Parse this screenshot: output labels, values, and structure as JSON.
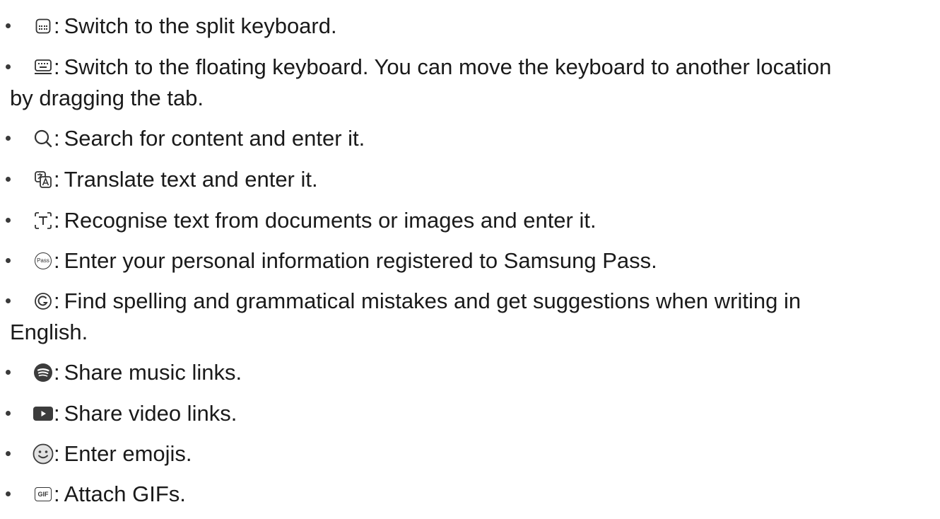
{
  "items": [
    {
      "icon": "split-keyboard-icon",
      "text": "Switch to the split keyboard."
    },
    {
      "icon": "floating-keyboard-icon",
      "text": "Switch to the floating keyboard. You can move the keyboard to another location",
      "text_cont": "by dragging the tab."
    },
    {
      "icon": "search-icon",
      "text": "Search for content and enter it."
    },
    {
      "icon": "translate-icon",
      "text": "Translate text and enter it."
    },
    {
      "icon": "text-recognition-icon",
      "text": "Recognise text from documents or images and enter it."
    },
    {
      "icon": "samsung-pass-icon",
      "text": "Enter your personal information registered to Samsung Pass.",
      "icon_label": "Pass"
    },
    {
      "icon": "grammarly-icon",
      "text": "Find spelling and grammatical mistakes and get suggestions when writing in",
      "text_cont": "English."
    },
    {
      "icon": "spotify-icon",
      "text": "Share music links."
    },
    {
      "icon": "youtube-icon",
      "text": "Share video links."
    },
    {
      "icon": "emoji-icon",
      "text": "Enter emojis."
    },
    {
      "icon": "gif-icon",
      "text": "Attach GIFs.",
      "icon_label": "GIF"
    }
  ],
  "separator": ":"
}
